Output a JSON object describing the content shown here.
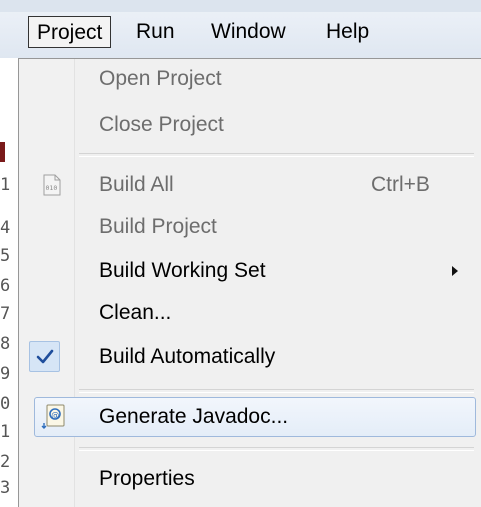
{
  "menubar": {
    "items": [
      "Project",
      "Run",
      "Window",
      "Help"
    ]
  },
  "gutter": {
    "line_digits": [
      "1",
      "4",
      "5",
      "6",
      "7",
      "8",
      "9",
      "0",
      "1",
      "2",
      "3"
    ]
  },
  "menu": {
    "open_project": "Open Project",
    "close_project": "Close Project",
    "build_all": "Build All",
    "build_all_shortcut": "Ctrl+B",
    "build_project": "Build Project",
    "build_working_set": "Build Working Set",
    "clean": "Clean...",
    "build_automatically": "Build Automatically",
    "build_automatically_checked": true,
    "generate_javadoc": "Generate Javadoc...",
    "properties": "Properties"
  },
  "icons": {
    "build_all": "binary-file-icon",
    "checkmark": "checkmark-icon",
    "javadoc": "javadoc-icon",
    "submenu": "submenu-arrow-icon"
  },
  "colors": {
    "hover_border": "#9fb9dc",
    "check_bg": "#d6e5f6",
    "check_mark": "#1f4e9c",
    "disabled_text": "#6d6d6d"
  }
}
